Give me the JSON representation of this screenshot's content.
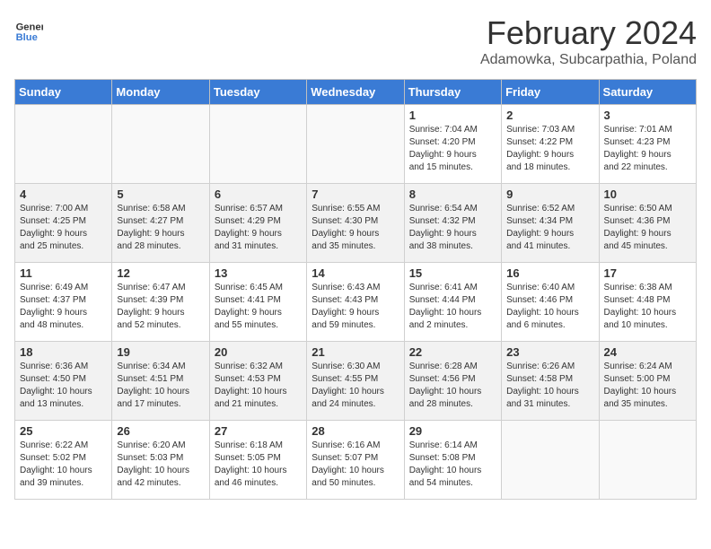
{
  "header": {
    "logo_general": "General",
    "logo_blue": "Blue",
    "month_title": "February 2024",
    "location": "Adamowka, Subcarpathia, Poland"
  },
  "days_of_week": [
    "Sunday",
    "Monday",
    "Tuesday",
    "Wednesday",
    "Thursday",
    "Friday",
    "Saturday"
  ],
  "weeks": [
    {
      "shade": false,
      "days": [
        {
          "num": "",
          "info": ""
        },
        {
          "num": "",
          "info": ""
        },
        {
          "num": "",
          "info": ""
        },
        {
          "num": "",
          "info": ""
        },
        {
          "num": "1",
          "info": "Sunrise: 7:04 AM\nSunset: 4:20 PM\nDaylight: 9 hours\nand 15 minutes."
        },
        {
          "num": "2",
          "info": "Sunrise: 7:03 AM\nSunset: 4:22 PM\nDaylight: 9 hours\nand 18 minutes."
        },
        {
          "num": "3",
          "info": "Sunrise: 7:01 AM\nSunset: 4:23 PM\nDaylight: 9 hours\nand 22 minutes."
        }
      ]
    },
    {
      "shade": true,
      "days": [
        {
          "num": "4",
          "info": "Sunrise: 7:00 AM\nSunset: 4:25 PM\nDaylight: 9 hours\nand 25 minutes."
        },
        {
          "num": "5",
          "info": "Sunrise: 6:58 AM\nSunset: 4:27 PM\nDaylight: 9 hours\nand 28 minutes."
        },
        {
          "num": "6",
          "info": "Sunrise: 6:57 AM\nSunset: 4:29 PM\nDaylight: 9 hours\nand 31 minutes."
        },
        {
          "num": "7",
          "info": "Sunrise: 6:55 AM\nSunset: 4:30 PM\nDaylight: 9 hours\nand 35 minutes."
        },
        {
          "num": "8",
          "info": "Sunrise: 6:54 AM\nSunset: 4:32 PM\nDaylight: 9 hours\nand 38 minutes."
        },
        {
          "num": "9",
          "info": "Sunrise: 6:52 AM\nSunset: 4:34 PM\nDaylight: 9 hours\nand 41 minutes."
        },
        {
          "num": "10",
          "info": "Sunrise: 6:50 AM\nSunset: 4:36 PM\nDaylight: 9 hours\nand 45 minutes."
        }
      ]
    },
    {
      "shade": false,
      "days": [
        {
          "num": "11",
          "info": "Sunrise: 6:49 AM\nSunset: 4:37 PM\nDaylight: 9 hours\nand 48 minutes."
        },
        {
          "num": "12",
          "info": "Sunrise: 6:47 AM\nSunset: 4:39 PM\nDaylight: 9 hours\nand 52 minutes."
        },
        {
          "num": "13",
          "info": "Sunrise: 6:45 AM\nSunset: 4:41 PM\nDaylight: 9 hours\nand 55 minutes."
        },
        {
          "num": "14",
          "info": "Sunrise: 6:43 AM\nSunset: 4:43 PM\nDaylight: 9 hours\nand 59 minutes."
        },
        {
          "num": "15",
          "info": "Sunrise: 6:41 AM\nSunset: 4:44 PM\nDaylight: 10 hours\nand 2 minutes."
        },
        {
          "num": "16",
          "info": "Sunrise: 6:40 AM\nSunset: 4:46 PM\nDaylight: 10 hours\nand 6 minutes."
        },
        {
          "num": "17",
          "info": "Sunrise: 6:38 AM\nSunset: 4:48 PM\nDaylight: 10 hours\nand 10 minutes."
        }
      ]
    },
    {
      "shade": true,
      "days": [
        {
          "num": "18",
          "info": "Sunrise: 6:36 AM\nSunset: 4:50 PM\nDaylight: 10 hours\nand 13 minutes."
        },
        {
          "num": "19",
          "info": "Sunrise: 6:34 AM\nSunset: 4:51 PM\nDaylight: 10 hours\nand 17 minutes."
        },
        {
          "num": "20",
          "info": "Sunrise: 6:32 AM\nSunset: 4:53 PM\nDaylight: 10 hours\nand 21 minutes."
        },
        {
          "num": "21",
          "info": "Sunrise: 6:30 AM\nSunset: 4:55 PM\nDaylight: 10 hours\nand 24 minutes."
        },
        {
          "num": "22",
          "info": "Sunrise: 6:28 AM\nSunset: 4:56 PM\nDaylight: 10 hours\nand 28 minutes."
        },
        {
          "num": "23",
          "info": "Sunrise: 6:26 AM\nSunset: 4:58 PM\nDaylight: 10 hours\nand 31 minutes."
        },
        {
          "num": "24",
          "info": "Sunrise: 6:24 AM\nSunset: 5:00 PM\nDaylight: 10 hours\nand 35 minutes."
        }
      ]
    },
    {
      "shade": false,
      "days": [
        {
          "num": "25",
          "info": "Sunrise: 6:22 AM\nSunset: 5:02 PM\nDaylight: 10 hours\nand 39 minutes."
        },
        {
          "num": "26",
          "info": "Sunrise: 6:20 AM\nSunset: 5:03 PM\nDaylight: 10 hours\nand 42 minutes."
        },
        {
          "num": "27",
          "info": "Sunrise: 6:18 AM\nSunset: 5:05 PM\nDaylight: 10 hours\nand 46 minutes."
        },
        {
          "num": "28",
          "info": "Sunrise: 6:16 AM\nSunset: 5:07 PM\nDaylight: 10 hours\nand 50 minutes."
        },
        {
          "num": "29",
          "info": "Sunrise: 6:14 AM\nSunset: 5:08 PM\nDaylight: 10 hours\nand 54 minutes."
        },
        {
          "num": "",
          "info": ""
        },
        {
          "num": "",
          "info": ""
        }
      ]
    }
  ]
}
